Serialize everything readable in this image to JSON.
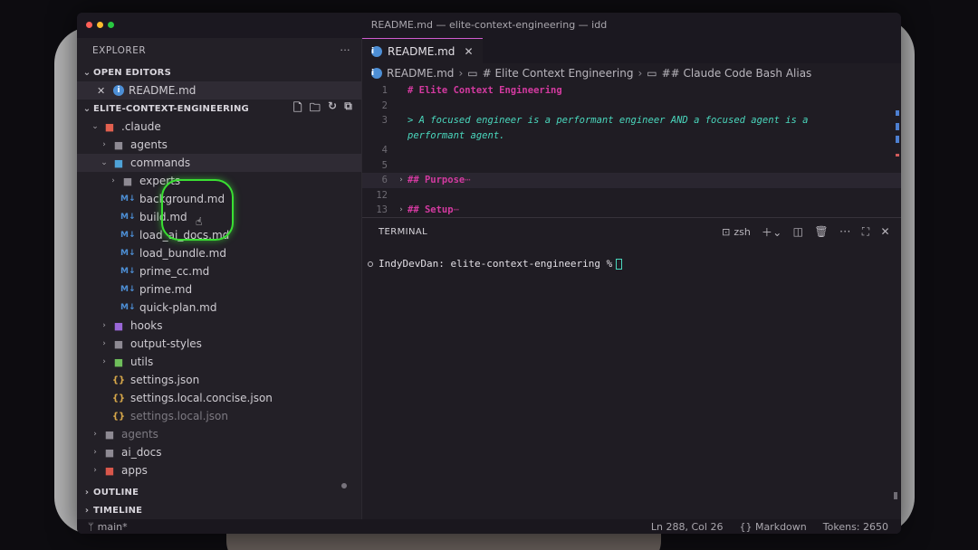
{
  "window": {
    "title": "README.md — elite-context-engineering — idd"
  },
  "explorer": {
    "header": "EXPLORER",
    "more": "···",
    "open_editors": {
      "label": "OPEN EDITORS",
      "items": [
        {
          "name": "README.md"
        }
      ]
    },
    "project": {
      "label": "ELITE-CONTEXT-ENGINEERING"
    },
    "tree": [
      {
        "label": ".claude",
        "type": "folder",
        "open": true,
        "depth": 0
      },
      {
        "label": "agents",
        "type": "folder",
        "open": false,
        "depth": 1
      },
      {
        "label": "commands",
        "type": "folder",
        "open": true,
        "depth": 1
      },
      {
        "label": "experts",
        "type": "folder",
        "open": false,
        "depth": 2
      },
      {
        "label": "background.md",
        "type": "md",
        "depth": 2
      },
      {
        "label": "build.md",
        "type": "md",
        "depth": 2
      },
      {
        "label": "load_ai_docs.md",
        "type": "md",
        "depth": 2
      },
      {
        "label": "load_bundle.md",
        "type": "md",
        "depth": 2
      },
      {
        "label": "prime_cc.md",
        "type": "md",
        "depth": 2
      },
      {
        "label": "prime.md",
        "type": "md",
        "depth": 2
      },
      {
        "label": "quick-plan.md",
        "type": "md",
        "depth": 2
      },
      {
        "label": "hooks",
        "type": "folder",
        "open": false,
        "depth": 1
      },
      {
        "label": "output-styles",
        "type": "folder",
        "open": false,
        "depth": 1
      },
      {
        "label": "utils",
        "type": "folder",
        "open": false,
        "depth": 1
      },
      {
        "label": "settings.json",
        "type": "json",
        "depth": 1
      },
      {
        "label": "settings.local.concise.json",
        "type": "json",
        "depth": 1
      },
      {
        "label": "settings.local.json",
        "type": "json",
        "depth": 1
      },
      {
        "label": "agents",
        "type": "folder",
        "open": false,
        "depth": 0
      },
      {
        "label": "ai_docs",
        "type": "folder",
        "open": false,
        "depth": 0
      },
      {
        "label": "apps",
        "type": "folder",
        "open": false,
        "depth": 0
      }
    ],
    "outline": "OUTLINE",
    "timeline": "TIMELINE"
  },
  "editor": {
    "tab": "README.md",
    "breadcrumbs": [
      "README.md",
      "# Elite Context Engineering",
      "## Claude Code Bash Alias"
    ],
    "lines": [
      {
        "n": "1",
        "text": "# Elite Context Engineering",
        "kind": "head"
      },
      {
        "n": "2",
        "text": "",
        "kind": "plain"
      },
      {
        "n": "3",
        "text": "> A focused engineer is a performant engineer AND a focused agent is a",
        "kind": "quote"
      },
      {
        "n": "",
        "text": "performant agent.",
        "kind": "quote"
      },
      {
        "n": "4",
        "text": "",
        "kind": "plain"
      },
      {
        "n": "5",
        "text": "",
        "kind": "plain"
      },
      {
        "n": "6",
        "text": "## Purpose",
        "kind": "head",
        "folded": true
      },
      {
        "n": "12",
        "text": "",
        "kind": "plain"
      },
      {
        "n": "13",
        "text": "## Setup",
        "kind": "head",
        "folded": true
      }
    ]
  },
  "terminal": {
    "label": "TERMINAL",
    "shell": "zsh",
    "prompt": "IndyDevDan: elite-context-engineering %"
  },
  "statusbar": {
    "branch": "main*",
    "position": "Ln 288, Col 26",
    "language": "Markdown",
    "tokens": "Tokens: 2650"
  }
}
